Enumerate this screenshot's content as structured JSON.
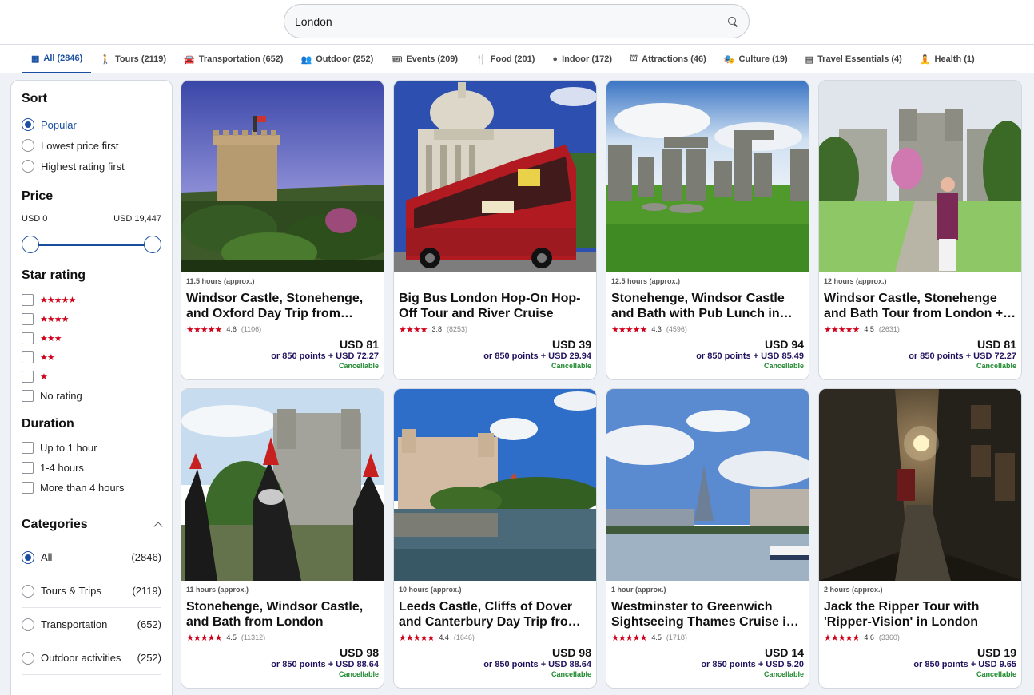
{
  "search": {
    "value": "London"
  },
  "tabs": [
    {
      "label": "All (2846)",
      "icon": "grid-icon"
    },
    {
      "label": "Tours (2119)",
      "icon": "hiker-icon"
    },
    {
      "label": "Transportation (652)",
      "icon": "car-icon"
    },
    {
      "label": "Outdoor (252)",
      "icon": "people-icon"
    },
    {
      "label": "Events (209)",
      "icon": "ticket-icon"
    },
    {
      "label": "Food (201)",
      "icon": "utensils-icon"
    },
    {
      "label": "Indoor (172)",
      "icon": "bowling-icon"
    },
    {
      "label": "Attractions (46)",
      "icon": "attraction-icon"
    },
    {
      "label": "Culture (19)",
      "icon": "mask-icon"
    },
    {
      "label": "Travel Essentials (4)",
      "icon": "document-icon"
    },
    {
      "label": "Health (1)",
      "icon": "yoga-icon"
    }
  ],
  "sidebar": {
    "sort": {
      "title": "Sort",
      "options": [
        "Popular",
        "Lowest price first",
        "Highest rating first"
      ],
      "selected": "Popular"
    },
    "price": {
      "title": "Price",
      "min": "USD 0",
      "max": "USD 19,447",
      "range_fraction": [
        0,
        1
      ]
    },
    "star_rating": {
      "title": "Star rating",
      "options": [
        {
          "stars": 5,
          "label": "★★★★★"
        },
        {
          "stars": 4,
          "label": "★★★★"
        },
        {
          "stars": 3,
          "label": "★★★"
        },
        {
          "stars": 2,
          "label": "★★"
        },
        {
          "stars": 1,
          "label": "★"
        }
      ],
      "no_rating": "No rating"
    },
    "duration": {
      "title": "Duration",
      "options": [
        "Up to 1 hour",
        "1-4 hours",
        "More than 4 hours"
      ]
    },
    "categories": {
      "title": "Categories",
      "items": [
        {
          "label": "All",
          "count": "(2846)",
          "selected": true
        },
        {
          "label": "Tours & Trips",
          "count": "(2119)",
          "selected": false
        },
        {
          "label": "Transportation",
          "count": "(652)",
          "selected": false
        },
        {
          "label": "Outdoor activities",
          "count": "(252)",
          "selected": false
        }
      ]
    }
  },
  "cards": [
    {
      "duration": "11.5 hours (approx.)",
      "title": "Windsor Castle, Stonehenge, and Oxford Day Trip from London",
      "stars": "★★★★★",
      "rating": "4.6",
      "reviews": "(1106)",
      "price": "USD 81",
      "points": "or 850 points + USD 72.27",
      "cancel": "Cancellable",
      "image": "windsor-tower-image"
    },
    {
      "duration": "",
      "title": "Big Bus London Hop-On Hop-Off Tour and River Cruise",
      "stars": "★★★★",
      "rating": "3.8",
      "reviews": "(8253)",
      "price": "USD 39",
      "points": "or 850 points + USD 29.94",
      "cancel": "Cancellable",
      "image": "red-bus-image"
    },
    {
      "duration": "12.5 hours (approx.)",
      "title": "Stonehenge, Windsor Castle and Bath with Pub Lunch in Lacock",
      "stars": "★★★★★",
      "rating": "4.3",
      "reviews": "(4596)",
      "price": "USD 94",
      "points": "or 850 points + USD 85.49",
      "cancel": "Cancellable",
      "image": "stonehenge-image"
    },
    {
      "duration": "12 hours (approx.)",
      "title": "Windsor Castle, Stonehenge and Bath Tour from London + Entry",
      "stars": "★★★★★",
      "rating": "4.5",
      "reviews": "(2631)",
      "price": "USD 81",
      "points": "or 850 points + USD 72.27",
      "cancel": "Cancellable",
      "image": "windsor-walk-image"
    },
    {
      "duration": "11 hours (approx.)",
      "title": "Stonehenge, Windsor Castle, and Bath from London",
      "stars": "★★★★★",
      "rating": "4.5",
      "reviews": "(11312)",
      "price": "USD 98",
      "points": "or 850 points + USD 88.64",
      "cancel": "Cancellable",
      "image": "guards-image"
    },
    {
      "duration": "10 hours (approx.)",
      "title": "Leeds Castle, Cliffs of Dover and Canterbury Day Trip from London",
      "stars": "★★★★★",
      "rating": "4.4",
      "reviews": "(1646)",
      "price": "USD 98",
      "points": "or 850 points + USD 88.64",
      "cancel": "Cancellable",
      "image": "leeds-castle-image"
    },
    {
      "duration": "1 hour (approx.)",
      "title": "Westminster to Greenwich Sightseeing Thames Cruise in London",
      "stars": "★★★★★",
      "rating": "4.5",
      "reviews": "(1718)",
      "price": "USD 14",
      "points": "or 850 points + USD 5.20",
      "cancel": "Cancellable",
      "image": "thames-image"
    },
    {
      "duration": "2 hours (approx.)",
      "title": "Jack the Ripper Tour with 'Ripper-Vision' in London",
      "stars": "★★★★★",
      "rating": "4.6",
      "reviews": "(3360)",
      "price": "USD 19",
      "points": "or 850 points + USD 9.65",
      "cancel": "Cancellable",
      "image": "alley-image"
    }
  ]
}
